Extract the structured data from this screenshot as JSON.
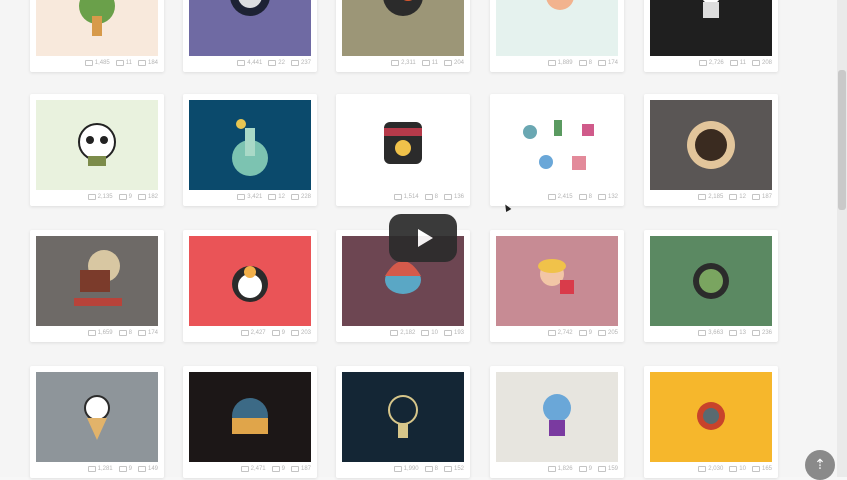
{
  "video": {
    "play_label": ""
  },
  "scroll_top_icon": "arrow-up-icon",
  "cards": [
    {
      "id": "c1",
      "views": "1,485",
      "likes": "11",
      "comments": "184",
      "bg": "#f8e9dc"
    },
    {
      "id": "c2",
      "views": "4,441",
      "likes": "22",
      "comments": "237",
      "bg": "#6f6aa3"
    },
    {
      "id": "c3",
      "views": "2,311",
      "likes": "11",
      "comments": "204",
      "bg": "#9c9677"
    },
    {
      "id": "c4",
      "views": "1,889",
      "likes": "8",
      "comments": "174",
      "bg": "#e5f2ee"
    },
    {
      "id": "c5",
      "views": "2,726",
      "likes": "11",
      "comments": "208",
      "bg": "#1f1f1f"
    },
    {
      "id": "c6",
      "views": "2,135",
      "likes": "9",
      "comments": "182",
      "bg": "#e9f2de"
    },
    {
      "id": "c7",
      "views": "3,421",
      "likes": "12",
      "comments": "228",
      "bg": "#0b4a6c"
    },
    {
      "id": "c8",
      "views": "1,514",
      "likes": "8",
      "comments": "136",
      "bg": "#ffffff"
    },
    {
      "id": "c9",
      "views": "2,415",
      "likes": "8",
      "comments": "132",
      "bg": "#ffffff"
    },
    {
      "id": "c10",
      "views": "2,185",
      "likes": "12",
      "comments": "187",
      "bg": "#5a5655"
    },
    {
      "id": "c11",
      "views": "1,659",
      "likes": "8",
      "comments": "174",
      "bg": "#6e6a67"
    },
    {
      "id": "c12",
      "views": "2,427",
      "likes": "9",
      "comments": "203",
      "bg": "#ea5457"
    },
    {
      "id": "c13",
      "views": "2,182",
      "likes": "10",
      "comments": "193",
      "bg": "#6d4652"
    },
    {
      "id": "c14",
      "views": "2,742",
      "likes": "9",
      "comments": "205",
      "bg": "#c78b94"
    },
    {
      "id": "c15",
      "views": "3,663",
      "likes": "13",
      "comments": "236",
      "bg": "#5b8962"
    },
    {
      "id": "c16",
      "views": "1,281",
      "likes": "9",
      "comments": "149",
      "bg": "#8e959a"
    },
    {
      "id": "c17",
      "views": "2,471",
      "likes": "9",
      "comments": "187",
      "bg": "#1c1717"
    },
    {
      "id": "c18",
      "views": "1,990",
      "likes": "8",
      "comments": "152",
      "bg": "#142635"
    },
    {
      "id": "c19",
      "views": "1,826",
      "likes": "9",
      "comments": "159",
      "bg": "#e7e5df"
    },
    {
      "id": "c20",
      "views": "2,030",
      "likes": "10",
      "comments": "165",
      "bg": "#f6b72c"
    }
  ]
}
